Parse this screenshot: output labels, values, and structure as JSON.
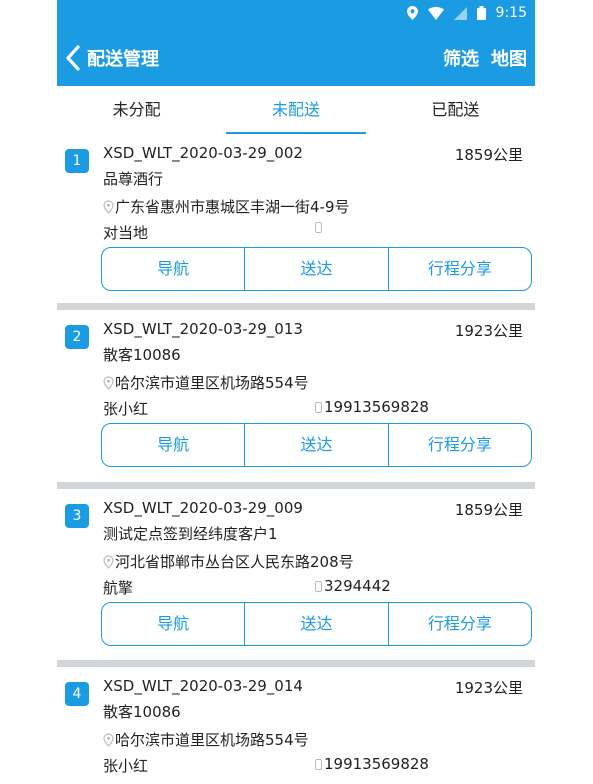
{
  "status_bar": {
    "time": "9:15",
    "icons": [
      "location-icon",
      "wifi-icon",
      "signal-icon",
      "battery-icon"
    ]
  },
  "app_bar": {
    "title": "配送管理",
    "filter_label": "筛选",
    "map_label": "地图"
  },
  "tabs": [
    {
      "label": "未分配"
    },
    {
      "label": "未配送",
      "active": true
    },
    {
      "label": "已配送"
    }
  ],
  "orders": [
    {
      "index": "1",
      "order_id": "XSD_WLT_2020-03-29_002",
      "distance": "1859公里",
      "customer": "品尊酒行",
      "address": "广东省惠州市惠城区丰湖一街4-9号",
      "contact": "对当地",
      "phone": ""
    },
    {
      "index": "2",
      "order_id": "XSD_WLT_2020-03-29_013",
      "distance": "1923公里",
      "customer": "散客10086",
      "address": "哈尔滨市道里区机场路554号",
      "contact": "张小红",
      "phone": "19913569828"
    },
    {
      "index": "3",
      "order_id": "XSD_WLT_2020-03-29_009",
      "distance": "1859公里",
      "customer": "测试定点签到经纬度客户1",
      "address": "河北省邯郸市丛台区人民东路208号",
      "contact": "航擎",
      "phone": "3294442"
    },
    {
      "index": "4",
      "order_id": "XSD_WLT_2020-03-29_014",
      "distance": "1923公里",
      "customer": "散客10086",
      "address": "哈尔滨市道里区机场路554号",
      "contact": "张小红",
      "phone": "19913569828"
    }
  ],
  "actions": {
    "navigate": "导航",
    "deliver": "送达",
    "share": "行程分享"
  },
  "colors": {
    "primary": "#1a9be2",
    "separator": "#d2d6d8"
  }
}
